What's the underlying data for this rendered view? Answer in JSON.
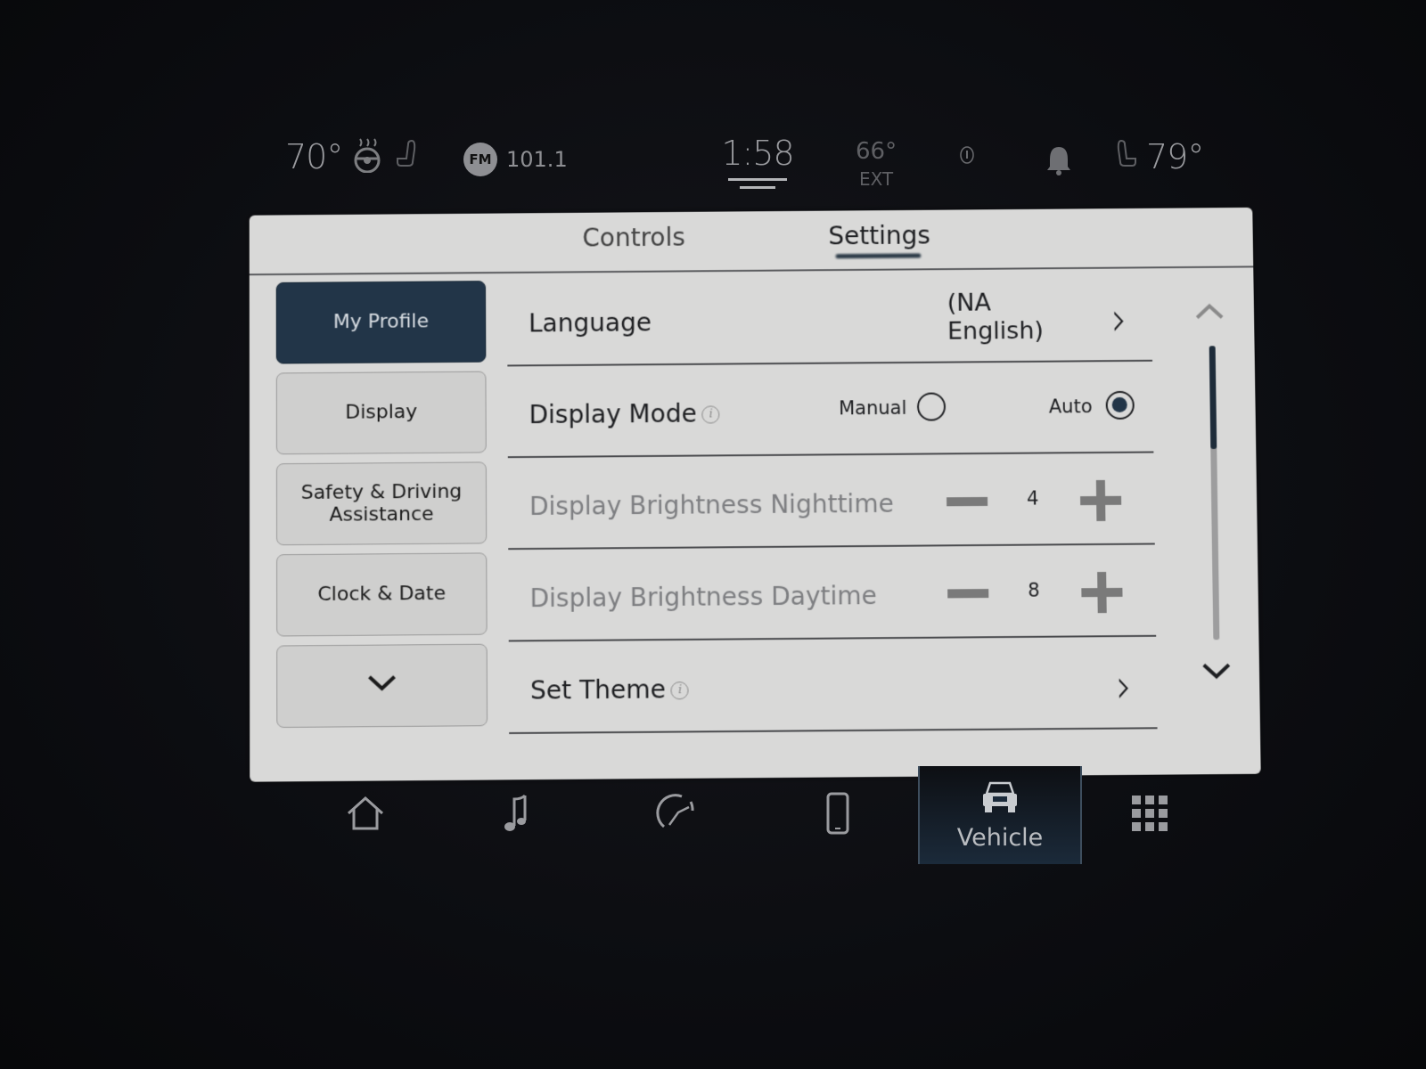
{
  "status_bar": {
    "driver_temp": "70°",
    "heated_wheel_icon": "heated-steering-wheel-icon",
    "heated_seat_icon": "heated-seat-icon",
    "radio_band": "FM",
    "radio_freq": "101.1",
    "time": "1:58",
    "ext_temp": "66°",
    "ext_label": "EXT",
    "alert_icon": "info-alert-icon",
    "bell_icon": "notification-bell-icon",
    "passenger_seat_icon": "passenger-seat-icon",
    "passenger_temp": "79°"
  },
  "tabs": [
    {
      "label": "Controls",
      "active": false
    },
    {
      "label": "Settings",
      "active": true
    }
  ],
  "sidebar": {
    "items": [
      {
        "label": "My Profile",
        "active": true
      },
      {
        "label": "Display",
        "active": false
      },
      {
        "label": "Safety & Driving Assistance",
        "active": false
      },
      {
        "label": "Clock & Date",
        "active": false
      }
    ],
    "more_icon": "chevron-down-icon"
  },
  "settings": {
    "language": {
      "label": "Language",
      "value_line1": "(NA",
      "value_line2": "English)"
    },
    "display_mode": {
      "label": "Display Mode",
      "info": "i",
      "options": [
        {
          "label": "Manual",
          "selected": false
        },
        {
          "label": "Auto",
          "selected": true
        }
      ]
    },
    "brightness_night": {
      "label": "Display Brightness Nighttime",
      "value": "4"
    },
    "brightness_day": {
      "label": "Display Brightness Daytime",
      "value": "8"
    },
    "set_theme": {
      "label": "Set Theme",
      "info": "i"
    }
  },
  "scrollbar": {
    "position_fraction": 0.0,
    "visible_fraction": 0.35
  },
  "bottom_nav": {
    "items": [
      {
        "icon": "home-icon",
        "label": ""
      },
      {
        "icon": "music-note-icon",
        "label": ""
      },
      {
        "icon": "navigation-compass-icon",
        "label": ""
      },
      {
        "icon": "phone-icon",
        "label": ""
      },
      {
        "icon": "truck-icon",
        "label": "Vehicle",
        "active": true
      },
      {
        "icon": "apps-grid-icon",
        "label": ""
      }
    ]
  }
}
